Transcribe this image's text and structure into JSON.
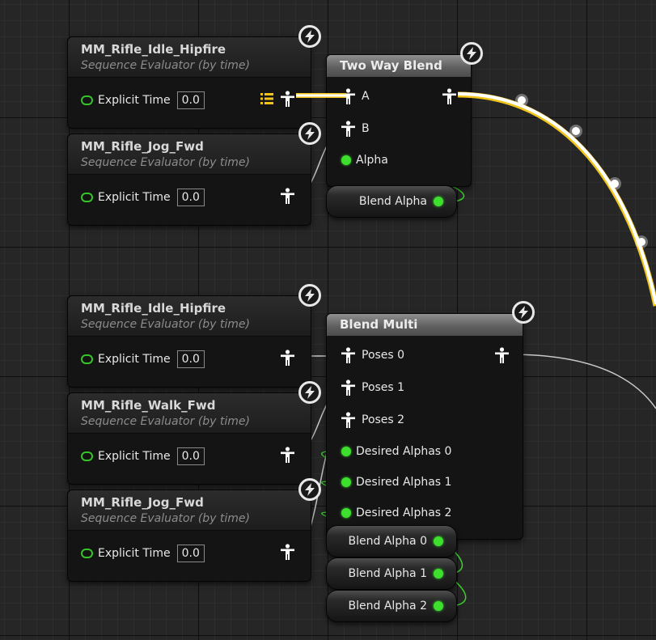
{
  "sequence_nodes": [
    {
      "title": "MM_Rifle_Idle_Hipfire",
      "subtitle": "Sequence Evaluator (by time)",
      "pin_label": "Explicit Time",
      "pin_value": "0.0"
    },
    {
      "title": "MM_Rifle_Jog_Fwd",
      "subtitle": "Sequence Evaluator (by time)",
      "pin_label": "Explicit Time",
      "pin_value": "0.0"
    },
    {
      "title": "MM_Rifle_Idle_Hipfire",
      "subtitle": "Sequence Evaluator (by time)",
      "pin_label": "Explicit Time",
      "pin_value": "0.0"
    },
    {
      "title": "MM_Rifle_Walk_Fwd",
      "subtitle": "Sequence Evaluator (by time)",
      "pin_label": "Explicit Time",
      "pin_value": "0.0"
    },
    {
      "title": "MM_Rifle_Jog_Fwd",
      "subtitle": "Sequence Evaluator (by time)",
      "pin_label": "Explicit Time",
      "pin_value": "0.0"
    }
  ],
  "two_way_blend": {
    "title": "Two Way Blend",
    "pins": [
      "A",
      "B",
      "Alpha"
    ]
  },
  "blend_multi": {
    "title": "Blend Multi",
    "pins": [
      "Poses 0",
      "Poses 1",
      "Poses 2",
      "Desired Alphas 0",
      "Desired Alphas 1",
      "Desired Alphas 2"
    ]
  },
  "variables": {
    "blend_alpha": "Blend Alpha",
    "blend_alpha_0": "Blend Alpha 0",
    "blend_alpha_1": "Blend Alpha 1",
    "blend_alpha_2": "Blend Alpha 2"
  },
  "colors": {
    "pose_wire": "#d0d0d0",
    "float_wire": "#3ad02c",
    "exec_highlight": "#ffffff",
    "selected_outline": "#f0c419",
    "pin_green": "#3ce02d"
  },
  "icons": {
    "fast_path": "lightning-bolt-icon",
    "pose": "pose-figure-icon",
    "float": "float-pin-icon",
    "cached": "list-icon"
  }
}
